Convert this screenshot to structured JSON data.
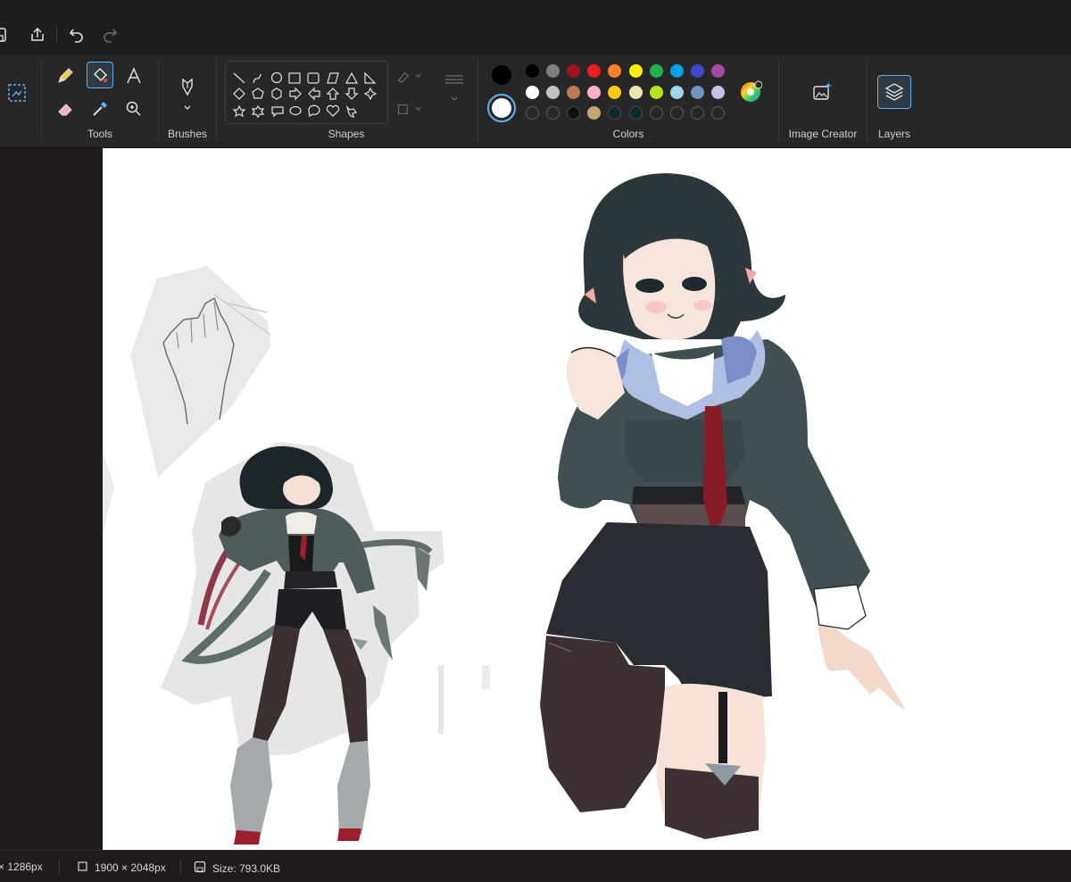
{
  "ribbon": {
    "groups": {
      "tools": "Tools",
      "brushes": "Brushes",
      "shapes": "Shapes",
      "colors": "Colors",
      "image_creator": "Image Creator",
      "layers": "Layers"
    },
    "colors": {
      "primary": "#000000",
      "secondary": "#ffffff",
      "row1": [
        "#000000",
        "#7f7f7f",
        "#a0141e",
        "#ee1c24",
        "#ff7f27",
        "#fff200",
        "#22b14c",
        "#00a2e8",
        "#3f48cc",
        "#a349a4"
      ],
      "row2": [
        "#ffffff",
        "#c3c3c3",
        "#b97a57",
        "#ffaec9",
        "#ffc90e",
        "#efe4b0",
        "#b5e61d",
        "#99d9ea",
        "#7092be",
        "#c8bfe7"
      ],
      "row3": [
        "empty",
        "empty",
        "#111111",
        "#c2a878",
        "#0f2730",
        "#0f2730",
        "empty",
        "empty",
        "empty",
        "empty"
      ]
    }
  },
  "canvas": {
    "content": "anime character illustration with reference sketch"
  },
  "status": {
    "cursor": "× 1286px",
    "canvas_size": "1900 × 2048px",
    "file_size": "Size: 793.0KB"
  }
}
